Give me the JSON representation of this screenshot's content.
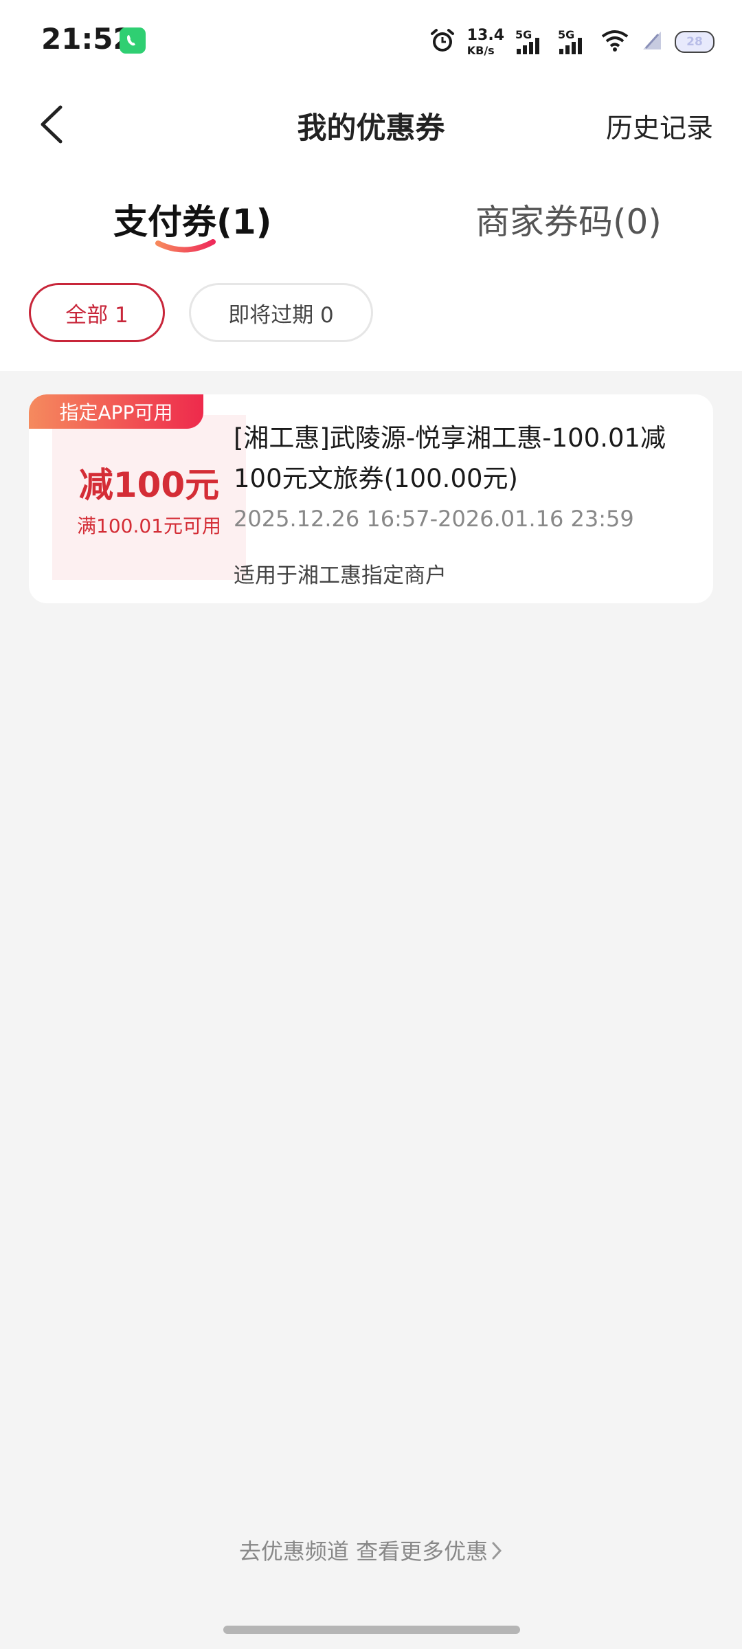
{
  "status_bar": {
    "time": "21:52",
    "net_speed_value": "13.4",
    "net_speed_unit": "KB/s",
    "signal1_label": "5G",
    "signal2_label": "5G",
    "battery_level": "28",
    "icons": [
      "wechat-icon",
      "alarm-icon",
      "signal-icon",
      "wifi-icon",
      "no-sim-icon",
      "battery-icon"
    ]
  },
  "navbar": {
    "title": "我的优惠券",
    "history_label": "历史记录"
  },
  "tabs": [
    {
      "label": "支付券(1)",
      "active": true
    },
    {
      "label": "商家券码(0)",
      "active": false
    }
  ],
  "filters": [
    {
      "label": "全部 1",
      "active": true
    },
    {
      "label": "即将过期 0",
      "active": false
    }
  ],
  "coupons": [
    {
      "tag": "指定APP可用",
      "amount": "减100元",
      "threshold": "满100.01元可用",
      "title": "[湘工惠]武陵源-悦享湘工惠-100.01减100元文旅券(100.00元)",
      "validity": "2025.12.26 16:57-2026.01.16 23:59",
      "scope": "适用于湘工惠指定商户"
    }
  ],
  "footer": {
    "more_link": "去优惠频道 查看更多优惠"
  },
  "colors": {
    "accent": "#c8263a",
    "coupon_red": "#d42d36",
    "tag_gradient_start": "#f58a5e",
    "tag_gradient_end": "#ee2a4c",
    "coupon_left_bg": "#fdf0f1",
    "page_bg": "#f4f4f4"
  }
}
